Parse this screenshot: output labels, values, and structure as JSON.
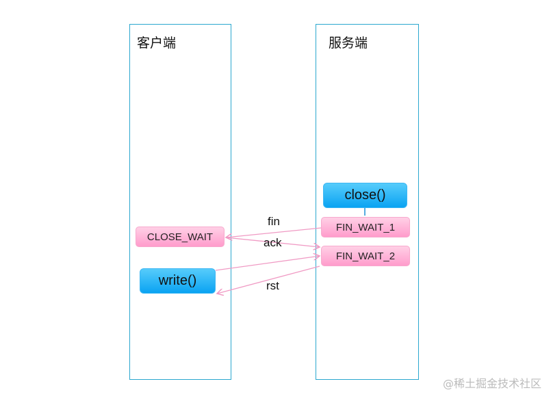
{
  "lanes": {
    "client": {
      "title": "客户端"
    },
    "server": {
      "title": "服务端"
    }
  },
  "client_states": {
    "close_wait": "CLOSE_WAIT"
  },
  "client_calls": {
    "write": "write()"
  },
  "server_calls": {
    "close": "close()"
  },
  "server_states": {
    "fin_wait_1": "FIN_WAIT_1",
    "fin_wait_2": "FIN_WAIT_2"
  },
  "messages": [
    {
      "label": "fin",
      "from": "FIN_WAIT_1",
      "to": "CLOSE_WAIT"
    },
    {
      "label": "ack",
      "from": "CLOSE_WAIT",
      "to": "FIN_WAIT_2"
    },
    {
      "label": "",
      "from": "write()",
      "to": "FIN_WAIT_2"
    },
    {
      "label": "rst",
      "from": "FIN_WAIT_2",
      "to": "write()"
    }
  ],
  "colors": {
    "lane_border": "#2aa7cf",
    "state_fill": "#ff9ccc",
    "call_fill": "#0aa3f2",
    "arrow": "#f09ac4",
    "close_arrow": "#1a8fd6"
  },
  "watermark": "@稀土掘金技术社区"
}
